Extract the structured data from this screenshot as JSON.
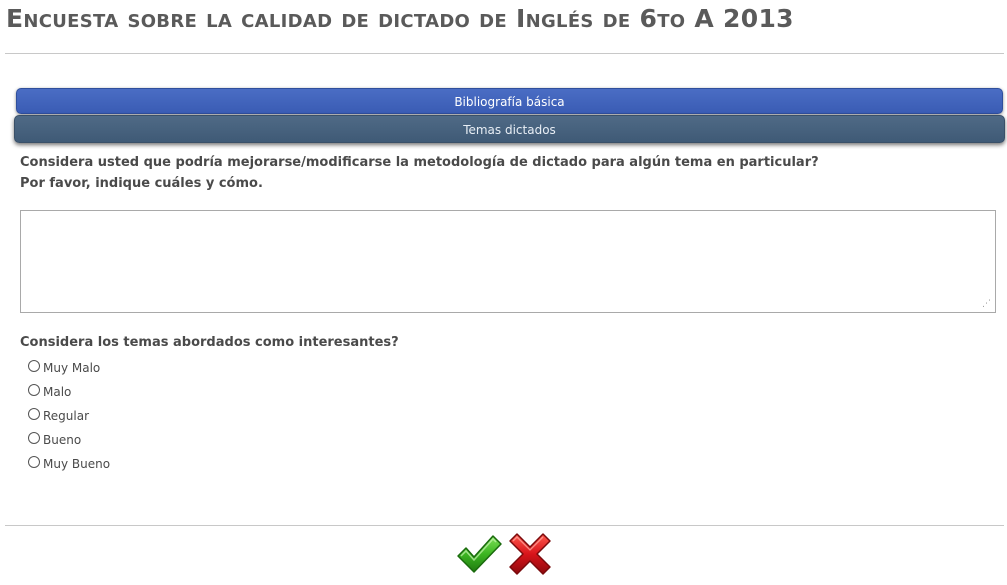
{
  "page": {
    "title": "Encuesta sobre la calidad de dictado de Inglés de 6to A 2013"
  },
  "sections": {
    "bibliografia_label": "Bibliografía básica",
    "temas_label": "Temas dictados"
  },
  "question1": {
    "line1": "Considera usted que podría mejorarse/modificarse la metodología de dictado para algún tema en particular?",
    "line2": "Por favor, indique cuáles y cómo.",
    "answer_value": ""
  },
  "question2": {
    "text": "Considera los temas abordados como interesantes?",
    "options": [
      {
        "label": "Muy Malo",
        "selected": false
      },
      {
        "label": "Malo",
        "selected": false
      },
      {
        "label": "Regular",
        "selected": false
      },
      {
        "label": "Bueno",
        "selected": false
      },
      {
        "label": "Muy Bueno",
        "selected": false
      }
    ]
  },
  "actions": {
    "confirm_icon": "green-checkmark-icon",
    "cancel_icon": "red-x-icon"
  },
  "colors": {
    "bibliografia_bar": "#3e60b8",
    "temas_bar": "#46607c",
    "confirm_green": "#3cb521",
    "cancel_red": "#d8141a"
  }
}
